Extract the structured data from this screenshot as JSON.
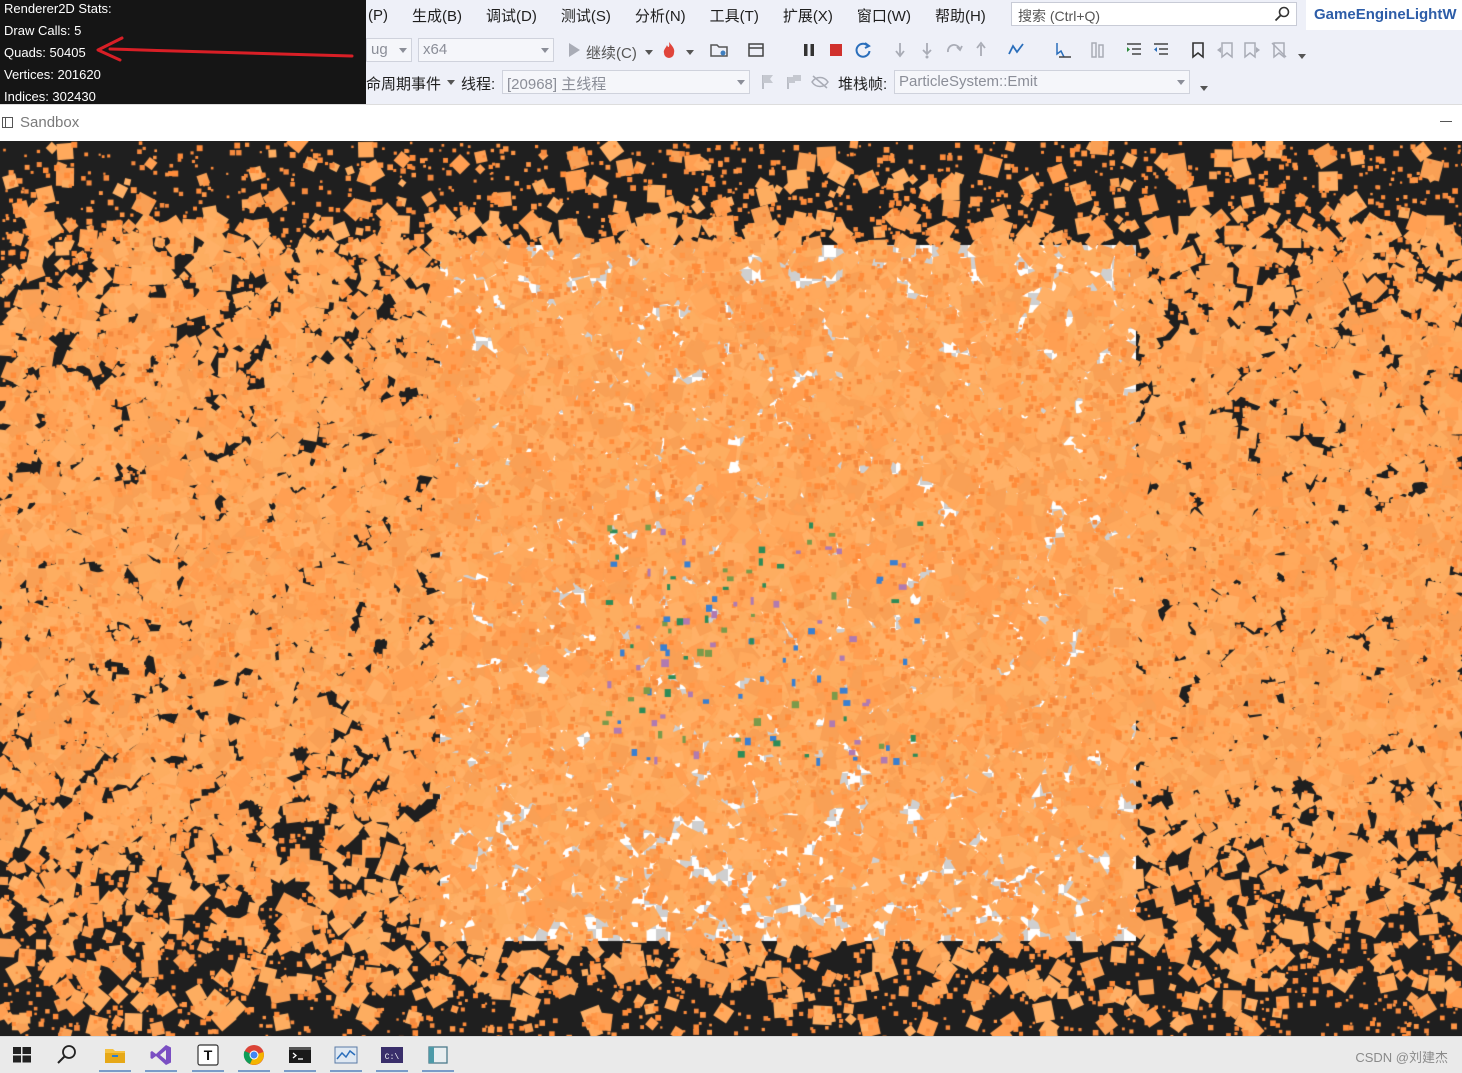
{
  "stats": {
    "title": "Renderer2D Stats:",
    "draw_calls": "Draw Calls: 5",
    "quads": "Quads: 50405",
    "vertices": "Vertices: 201620",
    "indices": "Indices: 302430"
  },
  "menu": [
    "(P)",
    "生成(B)",
    "调试(D)",
    "测试(S)",
    "分析(N)",
    "工具(T)",
    "扩展(X)",
    "窗口(W)",
    "帮助(H)"
  ],
  "search": {
    "placeholder": "搜索 (Ctrl+Q)"
  },
  "vs_title": "GameEngineLightW",
  "toolbar1": {
    "config": "ug",
    "platform": "x64",
    "continue": "继续(C)"
  },
  "toolbar2": {
    "lifecycle": "命周期事件",
    "thread_label": "线程:",
    "thread_value": "[20968] 主线程",
    "stackframe_label": "堆栈帧:",
    "stackframe_value": "ParticleSystem::Emit"
  },
  "window": {
    "title": "Sandbox"
  },
  "taskbar": {
    "icons": [
      "windows-start-icon",
      "search-icon",
      "file-explorer-icon",
      "visual-studio-icon",
      "typora-icon",
      "chrome-icon",
      "terminal-icon",
      "performance-monitor-icon",
      "console-icon",
      "sandbox-app-icon"
    ],
    "watermark": "CSDN @刘建杰"
  },
  "colors": {
    "particle": "#ffa95c",
    "particle_dark": "#f58a3f",
    "background": "#1f1f1f",
    "annotation_arrow": "#d81f26"
  }
}
